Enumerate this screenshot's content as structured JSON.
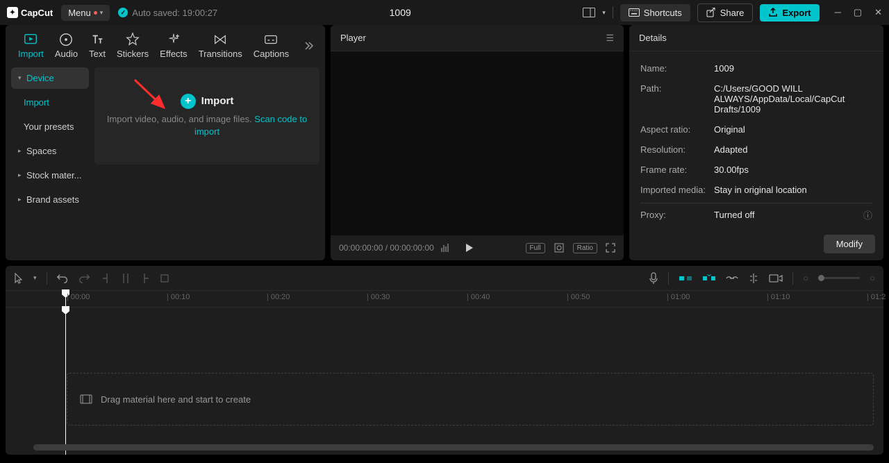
{
  "titlebar": {
    "logo": "CapCut",
    "menu": "Menu",
    "autosave": "Auto saved: 19:00:27",
    "project": "1009",
    "shortcuts": "Shortcuts",
    "share": "Share",
    "export": "Export"
  },
  "mediaTabs": {
    "import": "Import",
    "audio": "Audio",
    "text": "Text",
    "stickers": "Stickers",
    "effects": "Effects",
    "transitions": "Transitions",
    "captions": "Captions"
  },
  "sideTree": {
    "device": "Device",
    "import": "Import",
    "presets": "Your presets",
    "spaces": "Spaces",
    "stock": "Stock mater...",
    "brand": "Brand assets"
  },
  "importDrop": {
    "title": "Import",
    "hint": "Import video, audio, and image files. ",
    "link": "Scan code to import"
  },
  "player": {
    "title": "Player",
    "time": "00:00:00:00 / 00:00:00:00",
    "full": "Full",
    "ratio": "Ratio"
  },
  "details": {
    "title": "Details",
    "name_l": "Name:",
    "name_v": "1009",
    "path_l": "Path:",
    "path_v": "C:/Users/GOOD WILL ALWAYS/AppData/Local/CapCut Drafts/1009",
    "aspect_l": "Aspect ratio:",
    "aspect_v": "Original",
    "res_l": "Resolution:",
    "res_v": "Adapted",
    "fps_l": "Frame rate:",
    "fps_v": "30.00fps",
    "imp_l": "Imported media:",
    "imp_v": "Stay in original location",
    "proxy_l": "Proxy:",
    "proxy_v": "Turned off",
    "modify": "Modify"
  },
  "timeline": {
    "drop": "Drag material here and start to create",
    "ticks": [
      "00:00",
      "00:10",
      "00:20",
      "00:30",
      "00:40",
      "00:50",
      "01:00",
      "01:10",
      "01:2"
    ]
  }
}
